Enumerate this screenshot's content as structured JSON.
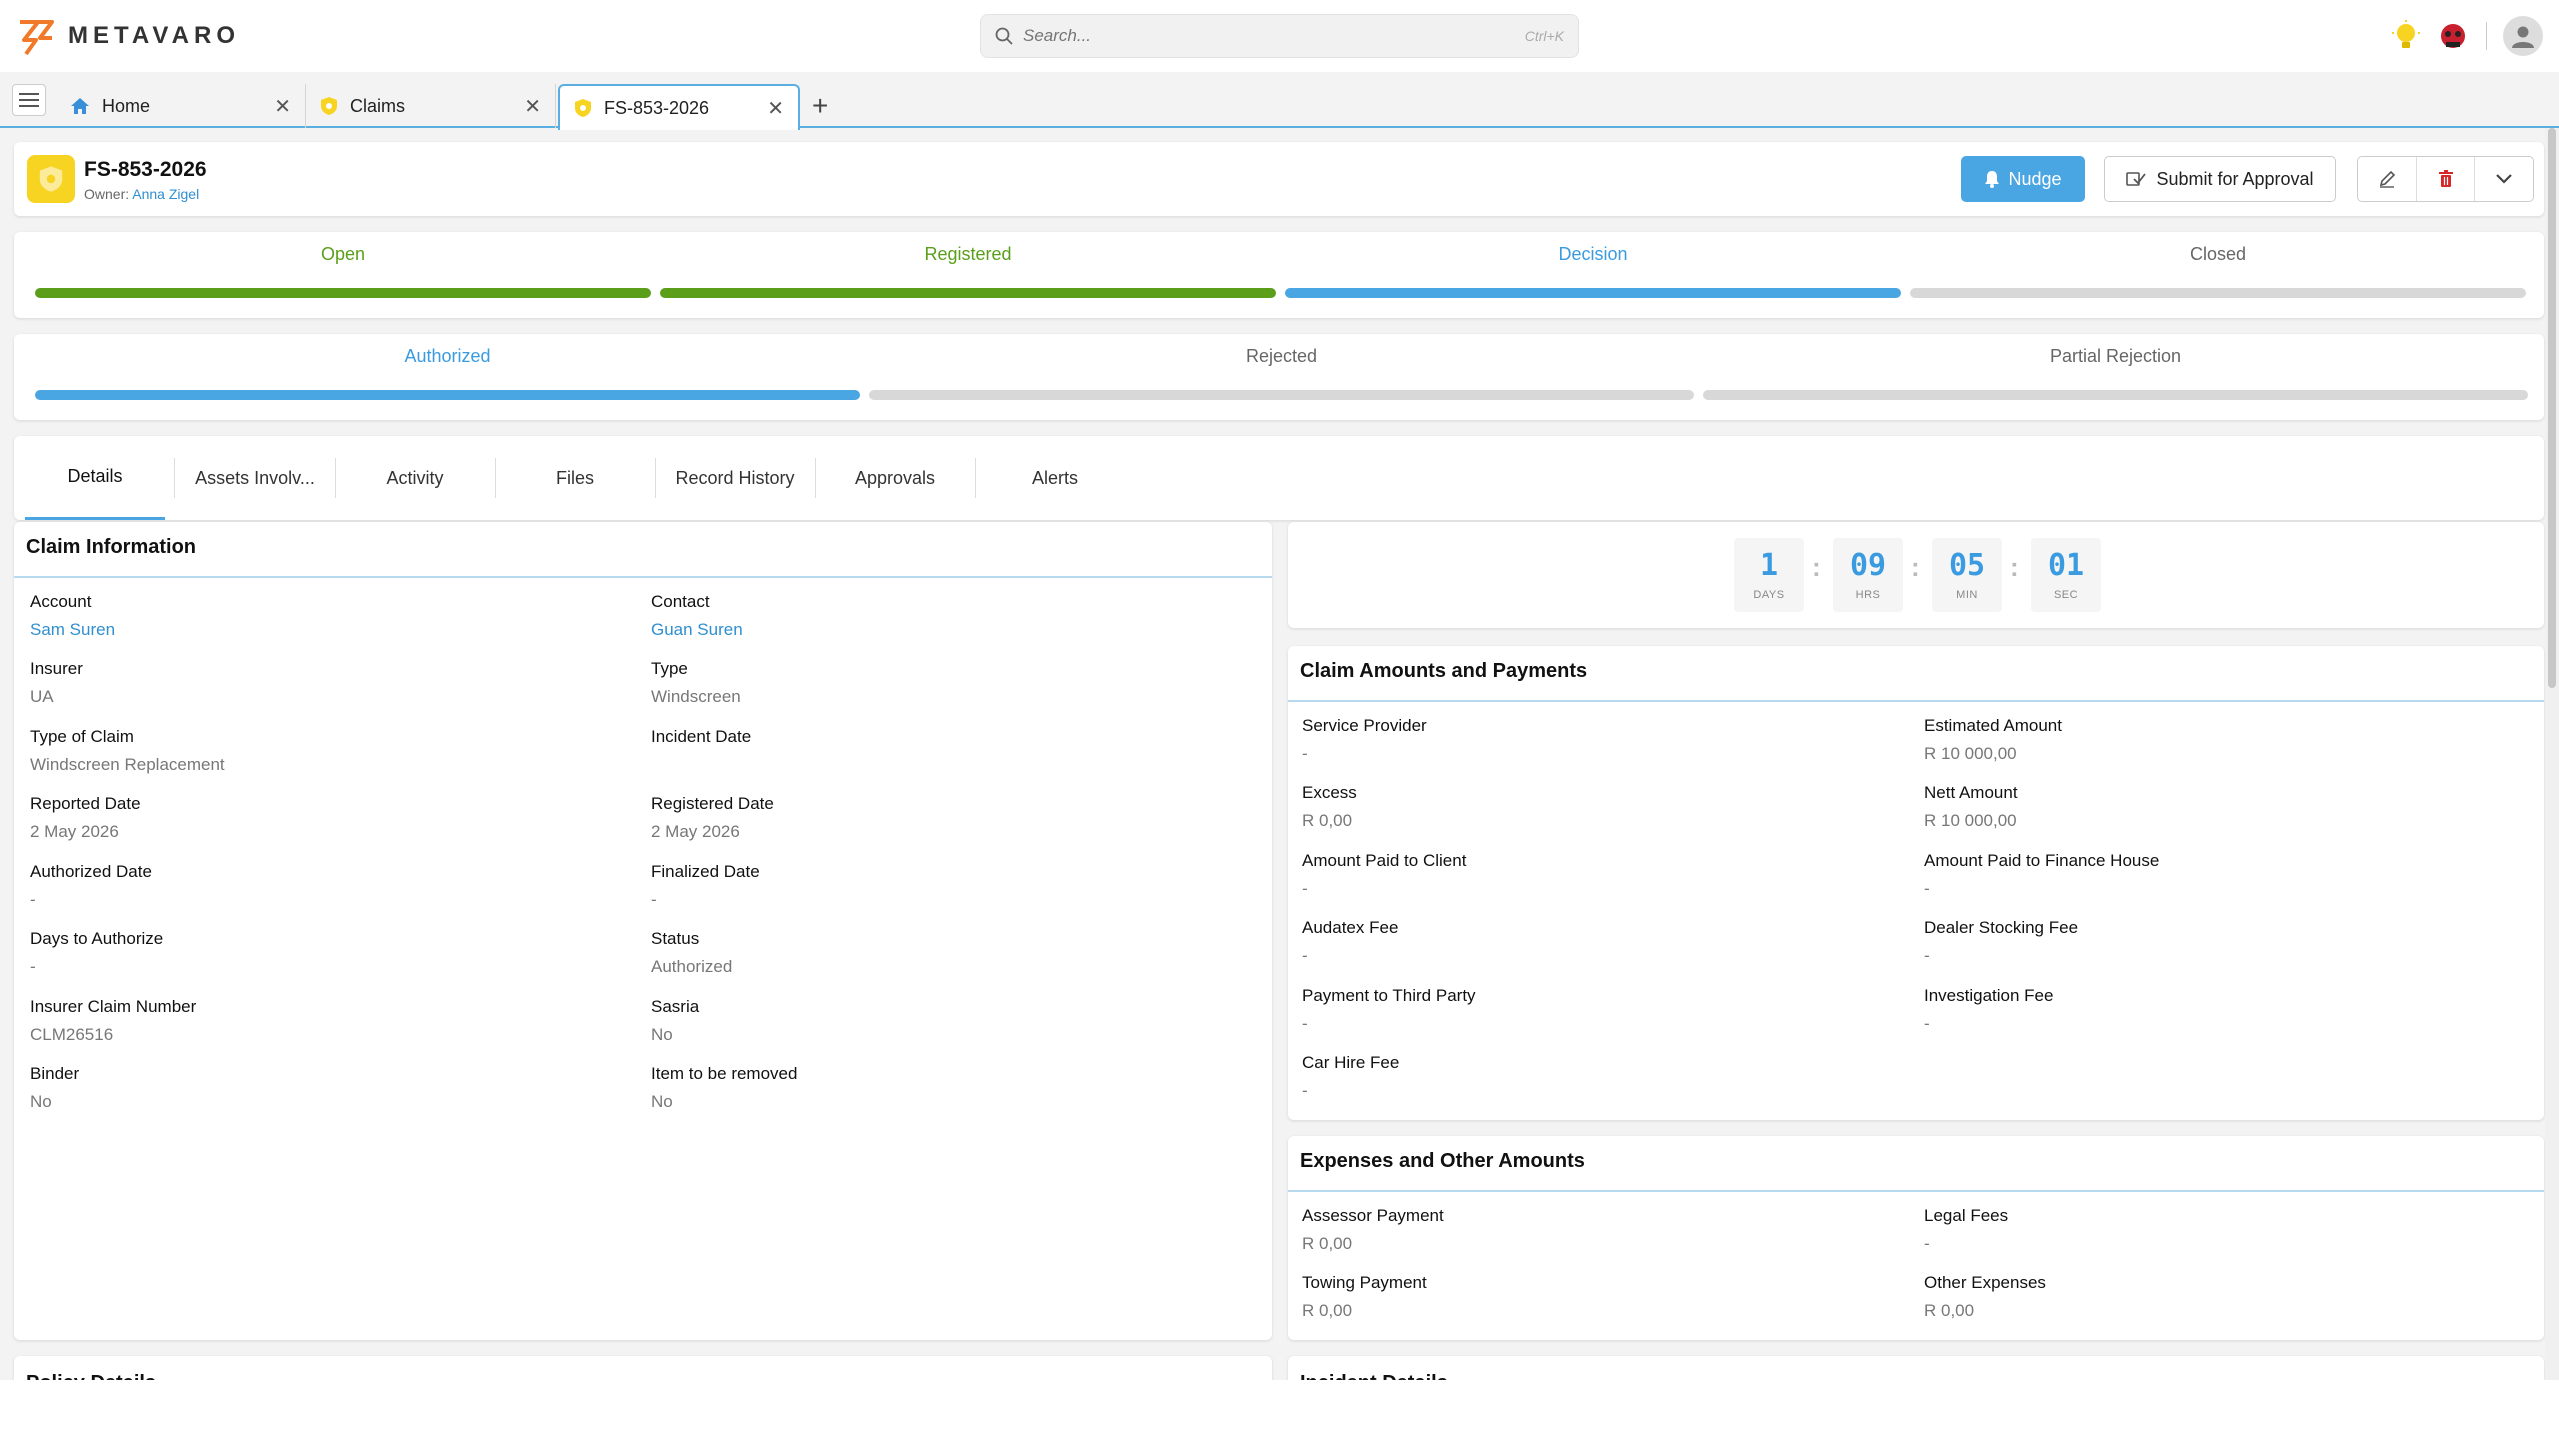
{
  "brand": {
    "name": "METAVARO",
    "accent": "#f07a2a"
  },
  "search": {
    "placeholder": "Search...",
    "shortcut": "Ctrl+K"
  },
  "tabs": [
    {
      "label": "Home",
      "icon": "home-icon"
    },
    {
      "label": "Claims",
      "icon": "shield-icon"
    },
    {
      "label": "FS-853-2026",
      "icon": "shield-icon",
      "active": true
    }
  ],
  "record": {
    "title": "FS-853-2026",
    "owner_label": "Owner:",
    "owner_name": "Anna Zigel",
    "nudge_label": "Nudge",
    "submit_label": "Submit for Approval"
  },
  "stages": [
    {
      "label": "Open",
      "color": "#5a9e1a",
      "status": "complete"
    },
    {
      "label": "Registered",
      "color": "#5a9e1a",
      "status": "complete"
    },
    {
      "label": "Decision",
      "color": "#4aa6e3",
      "status": "current"
    },
    {
      "label": "Closed",
      "color": "#666666",
      "status": "pending"
    }
  ],
  "substages": [
    {
      "label": "Authorized",
      "color": "#4aa6e3",
      "status": "current"
    },
    {
      "label": "Rejected",
      "color": "#666666",
      "status": "pending"
    },
    {
      "label": "Partial Rejection",
      "color": "#666666",
      "status": "pending"
    }
  ],
  "detail_tabs": [
    "Details",
    "Assets Involv...",
    "Activity",
    "Files",
    "Record History",
    "Approvals",
    "Alerts"
  ],
  "claim_info": {
    "title": "Claim Information",
    "fields": [
      {
        "label": "Account",
        "value": "Sam Suren",
        "link": true
      },
      {
        "label": "Contact",
        "value": "Guan Suren",
        "link": true
      },
      {
        "label": "Insurer",
        "value": "UA"
      },
      {
        "label": "Type",
        "value": "Windscreen"
      },
      {
        "label": "Type of Claim",
        "value": "Windscreen Replacement"
      },
      {
        "label": "Incident Date",
        "value": ""
      },
      {
        "label": "Reported Date",
        "value": "2 May 2026"
      },
      {
        "label": "Registered Date",
        "value": "2 May 2026"
      },
      {
        "label": "Authorized Date",
        "value": "-"
      },
      {
        "label": "Finalized Date",
        "value": "-"
      },
      {
        "label": "Days to Authorize",
        "value": "-"
      },
      {
        "label": "Status",
        "value": "Authorized"
      },
      {
        "label": "Insurer Claim Number",
        "value": "CLM26516"
      },
      {
        "label": "Sasria",
        "value": "No"
      },
      {
        "label": "Binder",
        "value": "No"
      },
      {
        "label": "Item to be removed",
        "value": "No"
      }
    ]
  },
  "timer": [
    {
      "value": "1",
      "unit": "DAYS"
    },
    {
      "value": "09",
      "unit": "HRS"
    },
    {
      "value": "05",
      "unit": "MIN"
    },
    {
      "value": "01",
      "unit": "SEC"
    }
  ],
  "amounts": {
    "title": "Claim Amounts and Payments",
    "fields": [
      {
        "label": "Service Provider",
        "value": "-"
      },
      {
        "label": "Estimated Amount",
        "value": "R 10 000,00"
      },
      {
        "label": "Excess",
        "value": "R 0,00"
      },
      {
        "label": "Nett Amount",
        "value": "R 10 000,00"
      },
      {
        "label": "Amount Paid to Client",
        "value": "-"
      },
      {
        "label": "Amount Paid to Finance House",
        "value": "-"
      },
      {
        "label": "Audatex Fee",
        "value": "-"
      },
      {
        "label": "Dealer Stocking Fee",
        "value": "-"
      },
      {
        "label": "Payment to Third Party",
        "value": "-"
      },
      {
        "label": "Investigation Fee",
        "value": "-"
      },
      {
        "label": "Car Hire Fee",
        "value": "-"
      }
    ]
  },
  "expenses": {
    "title": "Expenses and Other Amounts",
    "fields": [
      {
        "label": "Assessor Payment",
        "value": "R 0,00"
      },
      {
        "label": "Legal Fees",
        "value": "-"
      },
      {
        "label": "Towing Payment",
        "value": "R 0,00"
      },
      {
        "label": "Other Expenses",
        "value": "R 0,00"
      }
    ]
  },
  "lower_sections": {
    "left": "Policy Details",
    "right": "Incident Details"
  }
}
